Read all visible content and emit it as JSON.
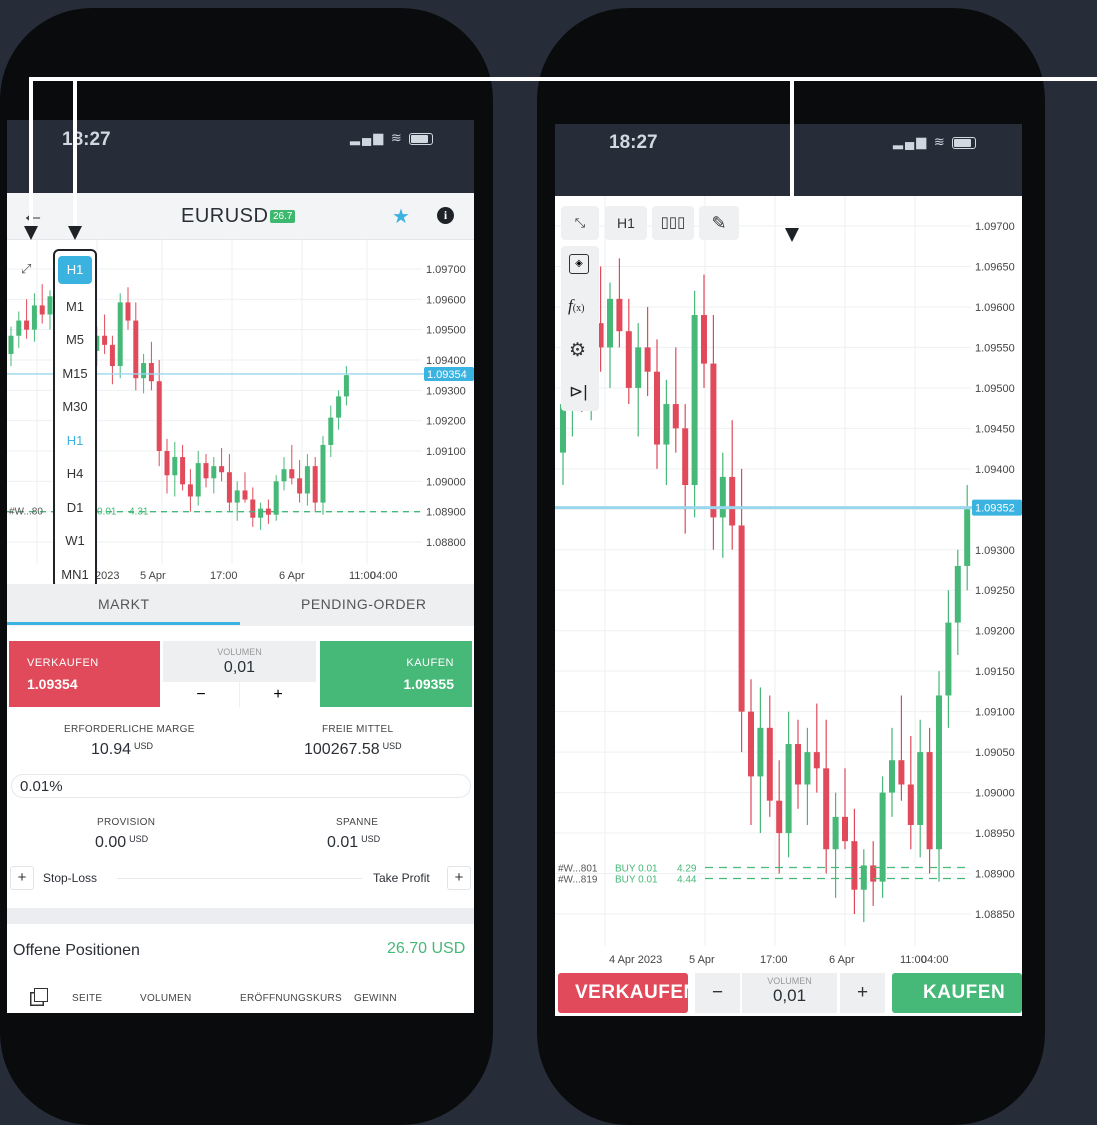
{
  "left": {
    "status_time": "18:27",
    "symbol": "EURUSD",
    "symbol_badge": "26.7",
    "timeframe_current": "H1",
    "timeframes": [
      "M1",
      "M5",
      "M15",
      "M30",
      "H1",
      "H4",
      "D1",
      "W1",
      "MN1"
    ],
    "price_levels": [
      "1.09700",
      "1.09600",
      "1.09500",
      "1.09400",
      "1.09300",
      "1.09200",
      "1.09100",
      "1.09000",
      "1.08900",
      "1.08800"
    ],
    "current_price_tag": "1.09354",
    "x_labels": [
      "2023",
      "5 Apr",
      "17:00",
      "6 Apr",
      "11:00",
      "04:00"
    ],
    "position_line": {
      "id": "#W...80",
      "vol": "0.01",
      "pnl": "4.31"
    },
    "tabs": [
      "MARKT",
      "PENDING-ORDER"
    ],
    "sell_label": "VERKAUFEN",
    "sell_price": "1.09354",
    "volume_label": "VOLUMEN",
    "volume_value": "0,01",
    "minus": "−",
    "plus": "+",
    "buy_label": "KAUFEN",
    "buy_price": "1.09355",
    "margin_label": "ERFORDERLICHE MARGE",
    "margin_value": "10.94",
    "free_label": "FREIE MITTEL",
    "free_value": "100267.58",
    "currency": "USD",
    "leverage_pct": "0.01%",
    "commission_label": "PROVISION",
    "commission_value": "0.00",
    "spread_label": "SPANNE",
    "spread_value": "0.01",
    "stop_loss": "Stop-Loss",
    "take_profit": "Take Profit",
    "open_positions_label": "Offene Positionen",
    "open_positions_value": "26.70 USD",
    "columns": [
      "SEITE",
      "VOLUMEN",
      "ERÖFFNUNGSKURS",
      "GEWINN"
    ]
  },
  "right": {
    "status_time": "18:27",
    "timeframe": "H1",
    "price_levels": [
      "1.09700",
      "1.09650",
      "1.09600",
      "1.09550",
      "1.09500",
      "1.09450",
      "1.09400",
      "1.09350",
      "1.09300",
      "1.09250",
      "1.09200",
      "1.09150",
      "1.09100",
      "1.09050",
      "1.09000",
      "1.08950",
      "1.08900",
      "1.08850"
    ],
    "current_price_tag": "1.09352",
    "x_labels": [
      "4 Apr 2023",
      "5 Apr",
      "17:00",
      "6 Apr",
      "11:00",
      "04:00"
    ],
    "positions": [
      {
        "id": "#W...801",
        "side": "BUY 0.01",
        "pnl": "4.29"
      },
      {
        "id": "#W...819",
        "side": "BUY 0.01",
        "pnl": "4.44"
      }
    ],
    "sell_label": "VERKAUFEN",
    "volume_label": "VOLUMEN",
    "volume_value": "0,01",
    "minus": "−",
    "plus": "+",
    "buy_label": "KAUFEN"
  },
  "colors": {
    "background": "#262d38",
    "bull": "#46b877",
    "bear": "#e04a5a",
    "accent": "#3bb3e0"
  }
}
